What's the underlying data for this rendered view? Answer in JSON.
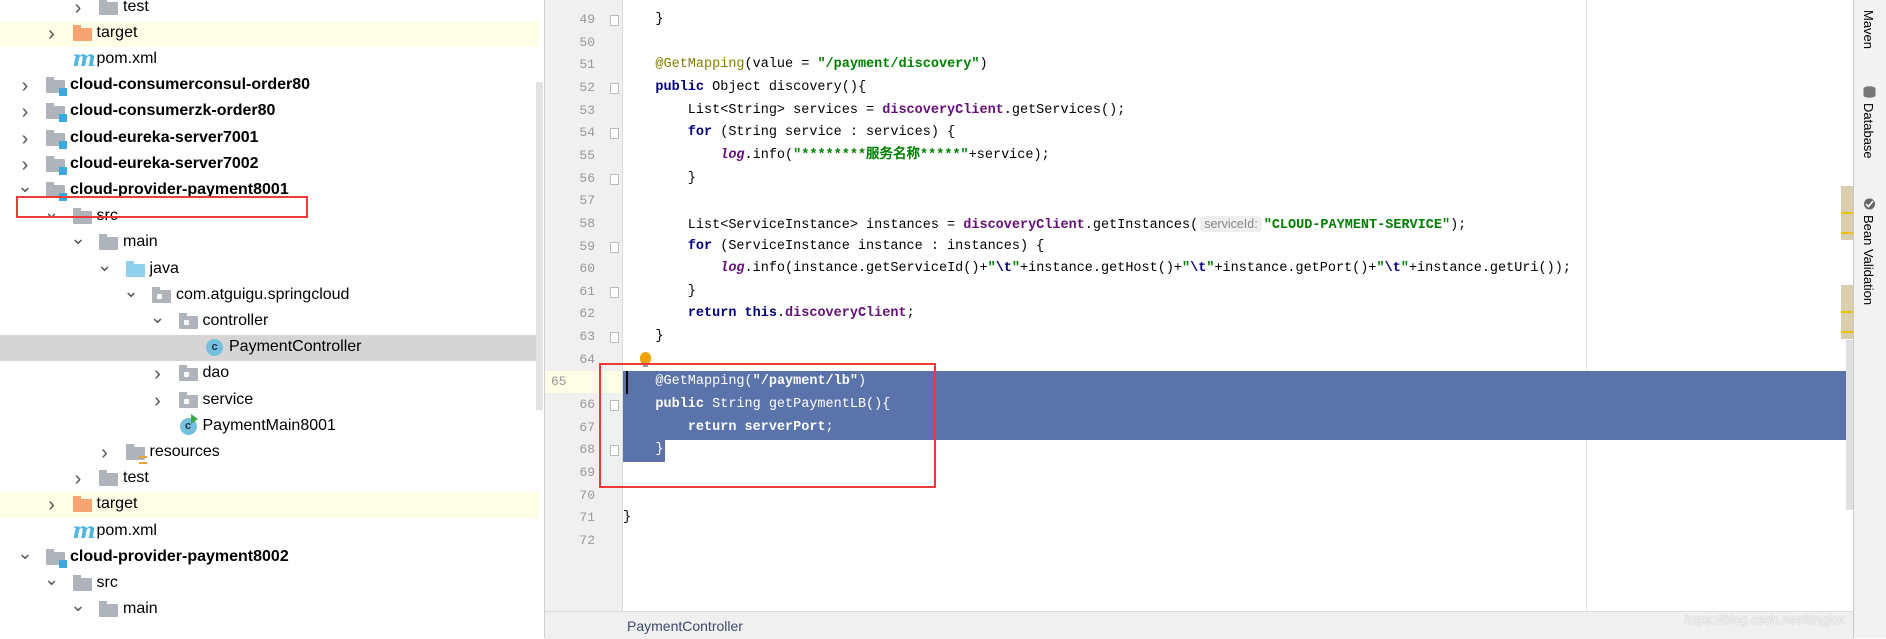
{
  "colors": {
    "selection": "#5a73aa",
    "keyword": "#000080",
    "string": "#008000",
    "annotation": "#808000",
    "field": "#660e7a",
    "highlight_box": "#f03a3a",
    "excluded_folder_row": "#fefde6",
    "selected_row": "#d5d5d5"
  },
  "project_tree": {
    "items": [
      {
        "label": "test",
        "level": 2,
        "chevron": "right",
        "icon": "folder-icon"
      },
      {
        "label": "target",
        "level": 1,
        "chevron": "right",
        "icon": "folder-excluded-icon",
        "row": "yellow"
      },
      {
        "label": "pom.xml",
        "level": 1,
        "chevron": "none",
        "icon": "maven-icon"
      },
      {
        "label": "cloud-consumerconsul-order80",
        "level": 0,
        "chevron": "right",
        "icon": "module-icon",
        "bold": true
      },
      {
        "label": "cloud-consumerzk-order80",
        "level": 0,
        "chevron": "right",
        "icon": "module-icon",
        "bold": true
      },
      {
        "label": "cloud-eureka-server7001",
        "level": 0,
        "chevron": "right",
        "icon": "module-icon",
        "bold": true
      },
      {
        "label": "cloud-eureka-server7002",
        "level": 0,
        "chevron": "right",
        "icon": "module-icon",
        "bold": true
      },
      {
        "label": "cloud-provider-payment8001",
        "level": 0,
        "chevron": "down",
        "icon": "module-icon",
        "bold": true,
        "highlighted": true
      },
      {
        "label": "src",
        "level": 1,
        "chevron": "down",
        "icon": "folder-icon"
      },
      {
        "label": "main",
        "level": 2,
        "chevron": "down",
        "icon": "folder-icon"
      },
      {
        "label": "java",
        "level": 3,
        "chevron": "down",
        "icon": "source-folder-icon"
      },
      {
        "label": "com.atguigu.springcloud",
        "level": 4,
        "chevron": "down",
        "icon": "package-icon"
      },
      {
        "label": "controller",
        "level": 5,
        "chevron": "down",
        "icon": "package-icon"
      },
      {
        "label": "PaymentController",
        "level": 6,
        "chevron": "none",
        "icon": "class-icon",
        "row": "selected"
      },
      {
        "label": "dao",
        "level": 5,
        "chevron": "right",
        "icon": "package-icon"
      },
      {
        "label": "service",
        "level": 5,
        "chevron": "right",
        "icon": "package-icon"
      },
      {
        "label": "PaymentMain8001",
        "level": 5,
        "chevron": "none",
        "icon": "spring-boot-class-icon"
      },
      {
        "label": "resources",
        "level": 3,
        "chevron": "right",
        "icon": "resources-folder-icon"
      },
      {
        "label": "test",
        "level": 2,
        "chevron": "right",
        "icon": "folder-icon"
      },
      {
        "label": "target",
        "level": 1,
        "chevron": "right",
        "icon": "folder-excluded-icon",
        "row": "yellow"
      },
      {
        "label": "pom.xml",
        "level": 1,
        "chevron": "none",
        "icon": "maven-icon"
      },
      {
        "label": "cloud-provider-payment8002",
        "level": 0,
        "chevron": "down",
        "icon": "module-icon",
        "bold": true
      },
      {
        "label": "src",
        "level": 1,
        "chevron": "down",
        "icon": "folder-icon"
      },
      {
        "label": "main",
        "level": 2,
        "chevron": "down",
        "icon": "folder-icon"
      }
    ]
  },
  "editor": {
    "current_line": 65,
    "selection": {
      "from_line": 65,
      "to_line": 68
    },
    "fold_lines": [
      49,
      52,
      54,
      56,
      59,
      61,
      63,
      66,
      68
    ],
    "lines": [
      {
        "n": "49",
        "tokens": [
          [
            "    }",
            ""
          ]
        ]
      },
      {
        "n": "50",
        "tokens": []
      },
      {
        "n": "51",
        "tokens": [
          [
            "    ",
            ""
          ],
          [
            "@GetMapping",
            "ann"
          ],
          [
            "(value = ",
            ""
          ],
          [
            "\"/payment/discovery\"",
            "str"
          ],
          [
            ")",
            ""
          ]
        ]
      },
      {
        "n": "52",
        "tokens": [
          [
            "    ",
            ""
          ],
          [
            "public",
            "kw"
          ],
          [
            " Object discovery(){",
            ""
          ]
        ]
      },
      {
        "n": "53",
        "tokens": [
          [
            "        List<String> services = ",
            ""
          ],
          [
            "discoveryClient",
            "field"
          ],
          [
            ".getServices();",
            ""
          ]
        ]
      },
      {
        "n": "54",
        "tokens": [
          [
            "        ",
            ""
          ],
          [
            "for",
            "kw"
          ],
          [
            " (String service : services) {",
            ""
          ]
        ]
      },
      {
        "n": "55",
        "tokens": [
          [
            "            ",
            ""
          ],
          [
            "log",
            "static"
          ],
          [
            ".info(",
            ""
          ],
          [
            "\"********服务名称*****\"",
            "str"
          ],
          [
            "+service);",
            ""
          ]
        ]
      },
      {
        "n": "56",
        "tokens": [
          [
            "        }",
            ""
          ]
        ]
      },
      {
        "n": "57",
        "tokens": []
      },
      {
        "n": "58",
        "tokens": [
          [
            "        List<ServiceInstance> instances = ",
            ""
          ],
          [
            "discoveryClient",
            "field"
          ],
          [
            ".getInstances(",
            ""
          ],
          [
            "serviceId:",
            "hint"
          ],
          [
            "\"CLOUD-PAYMENT-SERVICE\"",
            "str"
          ],
          [
            ");",
            ""
          ]
        ]
      },
      {
        "n": "59",
        "tokens": [
          [
            "        ",
            ""
          ],
          [
            "for",
            "kw"
          ],
          [
            " (ServiceInstance instance : instances) {",
            ""
          ]
        ]
      },
      {
        "n": "60",
        "tokens": [
          [
            "            ",
            ""
          ],
          [
            "log",
            "static"
          ],
          [
            ".info(instance.getServiceId()+",
            ""
          ],
          [
            "\"",
            "str"
          ],
          [
            "\\t",
            "esc"
          ],
          [
            "\"",
            "str"
          ],
          [
            "+instance.getHost()+",
            ""
          ],
          [
            "\"",
            "str"
          ],
          [
            "\\t",
            "esc"
          ],
          [
            "\"",
            "str"
          ],
          [
            "+instance.getPort()+",
            ""
          ],
          [
            "\"",
            "str"
          ],
          [
            "\\t",
            "esc"
          ],
          [
            "\"",
            "str"
          ],
          [
            "+instance.getUri());",
            ""
          ]
        ]
      },
      {
        "n": "61",
        "tokens": [
          [
            "        }",
            ""
          ]
        ]
      },
      {
        "n": "62",
        "tokens": [
          [
            "        ",
            ""
          ],
          [
            "return this",
            "kw"
          ],
          [
            ".",
            ""
          ],
          [
            "discoveryClient",
            "field"
          ],
          [
            ";",
            ""
          ]
        ]
      },
      {
        "n": "63",
        "tokens": [
          [
            "    }",
            ""
          ]
        ]
      },
      {
        "n": "64",
        "tokens": []
      },
      {
        "n": "65",
        "tokens": [
          [
            "    ",
            ""
          ],
          [
            "@GetMapping",
            "ann"
          ],
          [
            "(",
            ""
          ],
          [
            "\"/payment/lb\"",
            "str"
          ],
          [
            ")",
            ""
          ]
        ]
      },
      {
        "n": "66",
        "tokens": [
          [
            "    ",
            ""
          ],
          [
            "public",
            "kw"
          ],
          [
            " String getPaymentLB(){",
            ""
          ]
        ]
      },
      {
        "n": "67",
        "tokens": [
          [
            "        ",
            ""
          ],
          [
            "return",
            "kw"
          ],
          [
            " ",
            ""
          ],
          [
            "serverPort",
            "field"
          ],
          [
            ";",
            ""
          ]
        ]
      },
      {
        "n": "68",
        "tokens": [
          [
            "    }",
            ""
          ]
        ]
      },
      {
        "n": "69",
        "tokens": []
      },
      {
        "n": "70",
        "tokens": []
      },
      {
        "n": "71",
        "tokens": [
          [
            "}",
            ""
          ]
        ]
      },
      {
        "n": "72",
        "tokens": []
      }
    ]
  },
  "editor_tab": {
    "label": "PaymentController"
  },
  "right_toolbar": {
    "items": [
      {
        "label": "Maven",
        "icon": "maven-icon"
      },
      {
        "label": "Database",
        "icon": "database-icon"
      },
      {
        "label": "Bean Validation",
        "icon": "bean-validation-icon"
      }
    ]
  },
  "watermark": "https://blog.csdn.net/kingjok"
}
